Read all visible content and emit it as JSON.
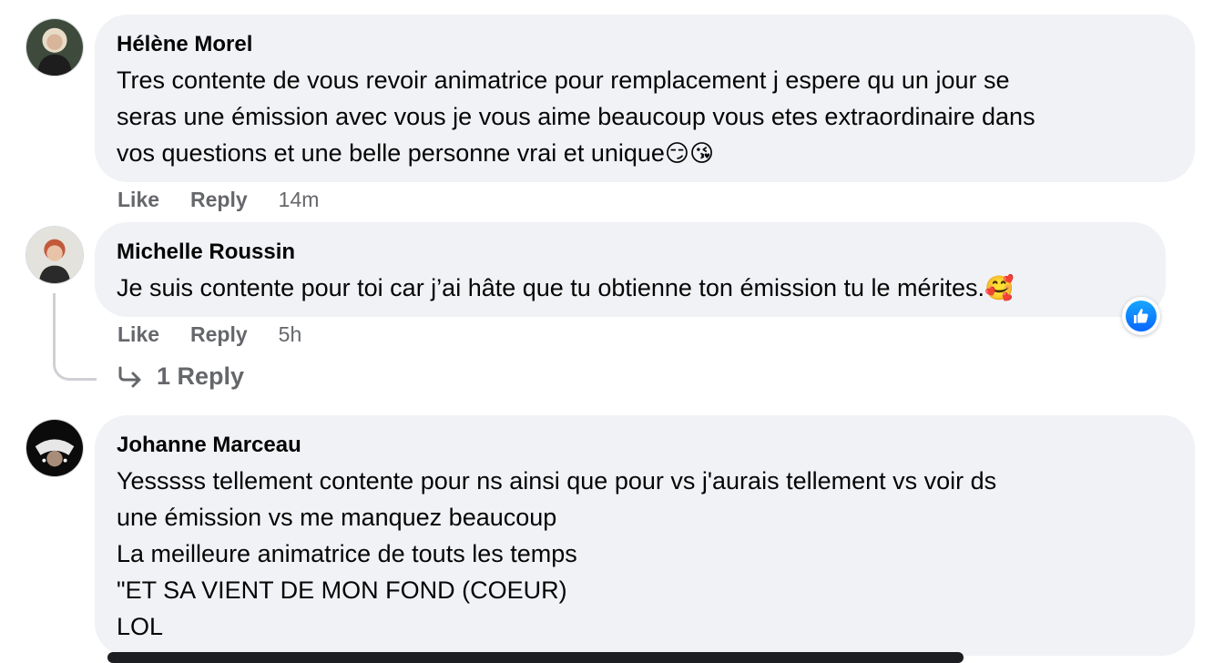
{
  "comments": [
    {
      "author": "Hélène Morel",
      "lines": [
        "Tres contente de vous revoir animatrice pour remplacement j espere qu un jour se",
        "seras une émission avec vous je vous aime beaucoup vous etes extraordinaire dans",
        "vos questions et une belle personne vrai et unique"
      ],
      "emojis": "😏😘",
      "like_label": "Like",
      "reply_label": "Reply",
      "time": "14m"
    },
    {
      "author": "Michelle Roussin",
      "lines": [
        "Je suis contente pour toi car j’ai hâte que tu obtienne ton émission tu le mérites."
      ],
      "emojis": "🥰",
      "like_label": "Like",
      "reply_label": "Reply",
      "time": "5h",
      "reaction_icon": "thumbs-up-icon",
      "reply_link": "1 Reply"
    },
    {
      "author": "Johanne Marceau",
      "lines": [
        "Yesssss tellement contente pour ns ainsi que pour vs j'aurais tellement vs voir ds",
        "une émission vs me manquez beaucoup",
        "La meilleure animatrice de touts les temps",
        "\"ET SA VIENT DE MON FOND (COEUR)",
        "LOL"
      ]
    }
  ],
  "colors": {
    "bubble": "#f0f2f5",
    "meta_text": "#65676b",
    "like_blue": "#0866ff"
  }
}
